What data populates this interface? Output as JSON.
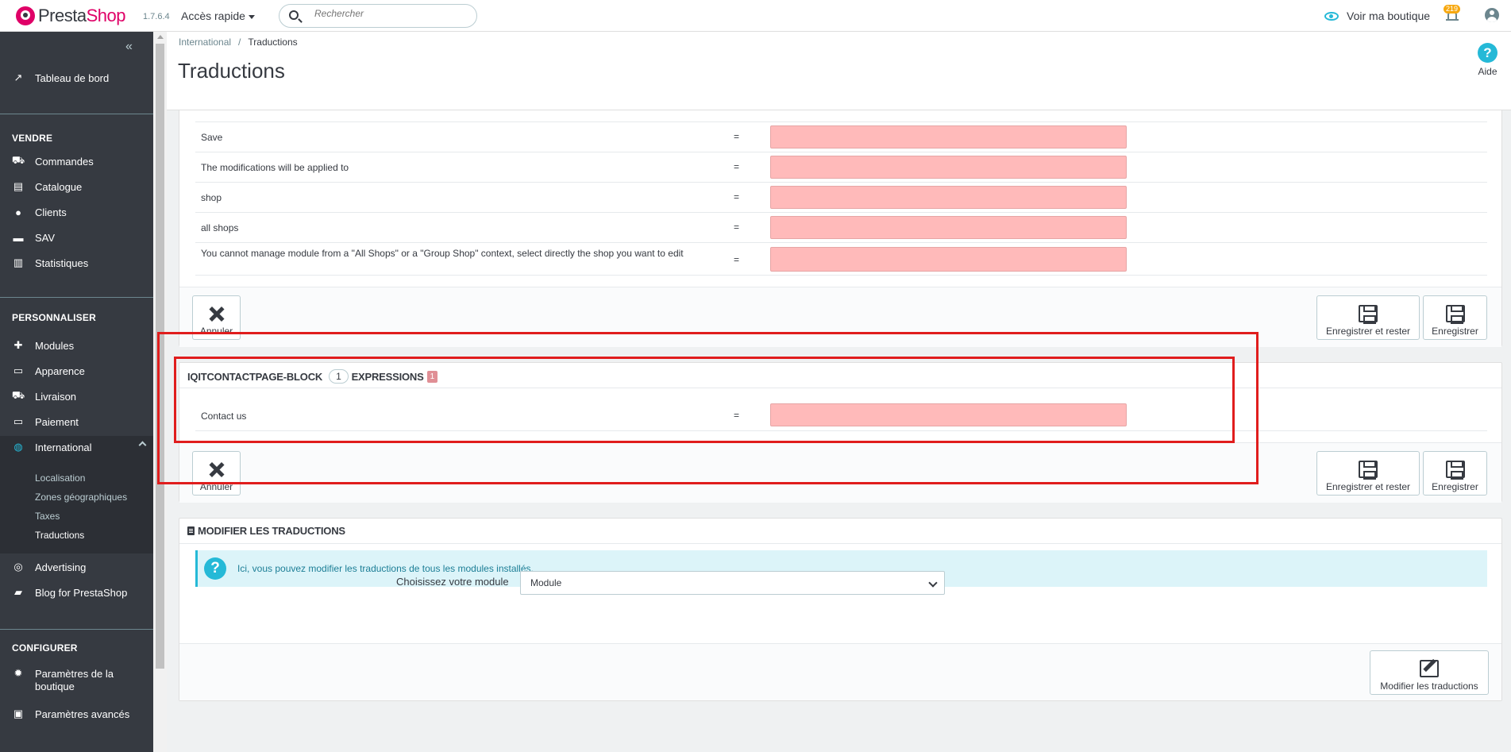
{
  "header": {
    "logo_presta": "Presta",
    "logo_shop": "Shop",
    "version": "1.7.6.4",
    "quick_access": "Accès rapide",
    "search_placeholder": "Rechercher",
    "view_shop": "Voir ma boutique",
    "notifications_count": "219"
  },
  "sidebar": {
    "collapse": "«",
    "dashboard": "Tableau de bord",
    "section_sell": "VENDRE",
    "sell_items": [
      "Commandes",
      "Catalogue",
      "Clients",
      "SAV",
      "Statistiques"
    ],
    "section_customize": "PERSONNALISER",
    "customize_items": [
      "Modules",
      "Apparence",
      "Livraison",
      "Paiement",
      "International"
    ],
    "international_sub": [
      "Localisation",
      "Zones géographiques",
      "Taxes",
      "Traductions"
    ],
    "extra_items": [
      "Advertising",
      "Blog for PrestaShop"
    ],
    "section_configure": "CONFIGURER",
    "configure_items": [
      "Paramètres de la boutique",
      "Paramètres avancés"
    ]
  },
  "page": {
    "breadcrumb_parent": "International",
    "breadcrumb_sep": "/",
    "breadcrumb_current": "Traductions",
    "title": "Traductions",
    "help": "Aide"
  },
  "panel1": {
    "rows": [
      {
        "label": "Save",
        "eq": "="
      },
      {
        "label": "The modifications will be applied to",
        "eq": "="
      },
      {
        "label": "shop",
        "eq": "="
      },
      {
        "label": "all shops",
        "eq": "="
      },
      {
        "label": "You cannot manage module from a \"All Shops\" or a \"Group Shop\" context, select directly the shop you want to edit",
        "eq": "="
      }
    ],
    "cancel": "Annuler",
    "save_stay": "Enregistrer et rester",
    "save": "Enregistrer"
  },
  "panel2": {
    "module": "IQITCONTACTPAGE-BLOCK",
    "count": "1",
    "expressions": "EXPRESSIONS",
    "missing": "1",
    "rows": [
      {
        "label": "Contact us",
        "eq": "="
      }
    ],
    "cancel": "Annuler",
    "save_stay": "Enregistrer et rester",
    "save": "Enregistrer"
  },
  "panel3": {
    "title": "MODIFIER LES TRADUCTIONS",
    "alert": "Ici, vous pouvez modifier les traductions de tous les modules installés.",
    "select_label": "Choisissez votre module",
    "select_value": "Module",
    "edit_button": "Modifier les traductions"
  },
  "colors": {
    "accent": "#25b9d7",
    "brand": "#df0067",
    "missing_field": "#ffbaba",
    "highlight": "#e01d1d"
  }
}
